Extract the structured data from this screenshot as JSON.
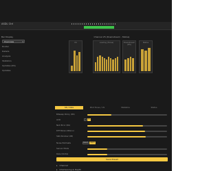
{
  "app": {
    "title": "ASDL Ctrl",
    "meter_level": 1.0
  },
  "sidebar": {
    "section_label": "Bar Display",
    "select_value": "Overview",
    "items": [
      "Router",
      "Details",
      "Analysis",
      "Statistics",
      "Updates (RS)",
      "Updates"
    ]
  },
  "main": {
    "graph_title": "Channel 25 (Downstream - Status)",
    "panels": [
      {
        "title": "US",
        "bars": [
          0.2,
          0.8,
          0.6,
          0.75
        ]
      },
      {
        "title": "Loading (Tones)",
        "bars": [
          0.35,
          0.55,
          0.6,
          0.55,
          0.5,
          0.45,
          0.55,
          0.5,
          0.45,
          0.5,
          0.55
        ]
      },
      {
        "title": "Downstream (DS)",
        "bars": [
          0.45,
          0.5,
          0.55,
          0.5
        ]
      },
      {
        "title": "Status",
        "bars": [
          0.85,
          0.8,
          0.9
        ]
      }
    ],
    "tabs": [
      "SN / Data",
      "Pilot Tones / US",
      "Statistics",
      "Status"
    ],
    "active_tab": 0,
    "controls": [
      {
        "label": "Bitswap Policy (RS)",
        "value": 0.3,
        "type": "slider"
      },
      {
        "label": "ACD",
        "toggle_value": "On",
        "type": "toggle"
      },
      {
        "label": "NLD Error (RS)",
        "value": 0.7,
        "type": "slider"
      },
      {
        "label": "Diff Noise (Attenu)",
        "value": 0.72,
        "type": "slider"
      },
      {
        "label": "SRA Window (dB)",
        "value": 0.73,
        "type": "slider"
      },
      {
        "label": "Noise Estimate",
        "button1": "Reset",
        "button2": "Apply",
        "type": "buttons"
      },
      {
        "label": "Sensor Mode",
        "value": 0.25,
        "type": "slider"
      },
      {
        "label": "Rate (Kbit/s)",
        "value": 0.25,
        "type": "slider"
      }
    ],
    "apply_button": "Save Preset"
  },
  "sections": [
    {
      "label": "Channel"
    },
    {
      "label": "Interleaving & Depth"
    }
  ],
  "colors": {
    "accent": "#f5c842",
    "bar": "#c9a237",
    "bg": "#1a1a1a",
    "meter": "#3ec24a"
  }
}
